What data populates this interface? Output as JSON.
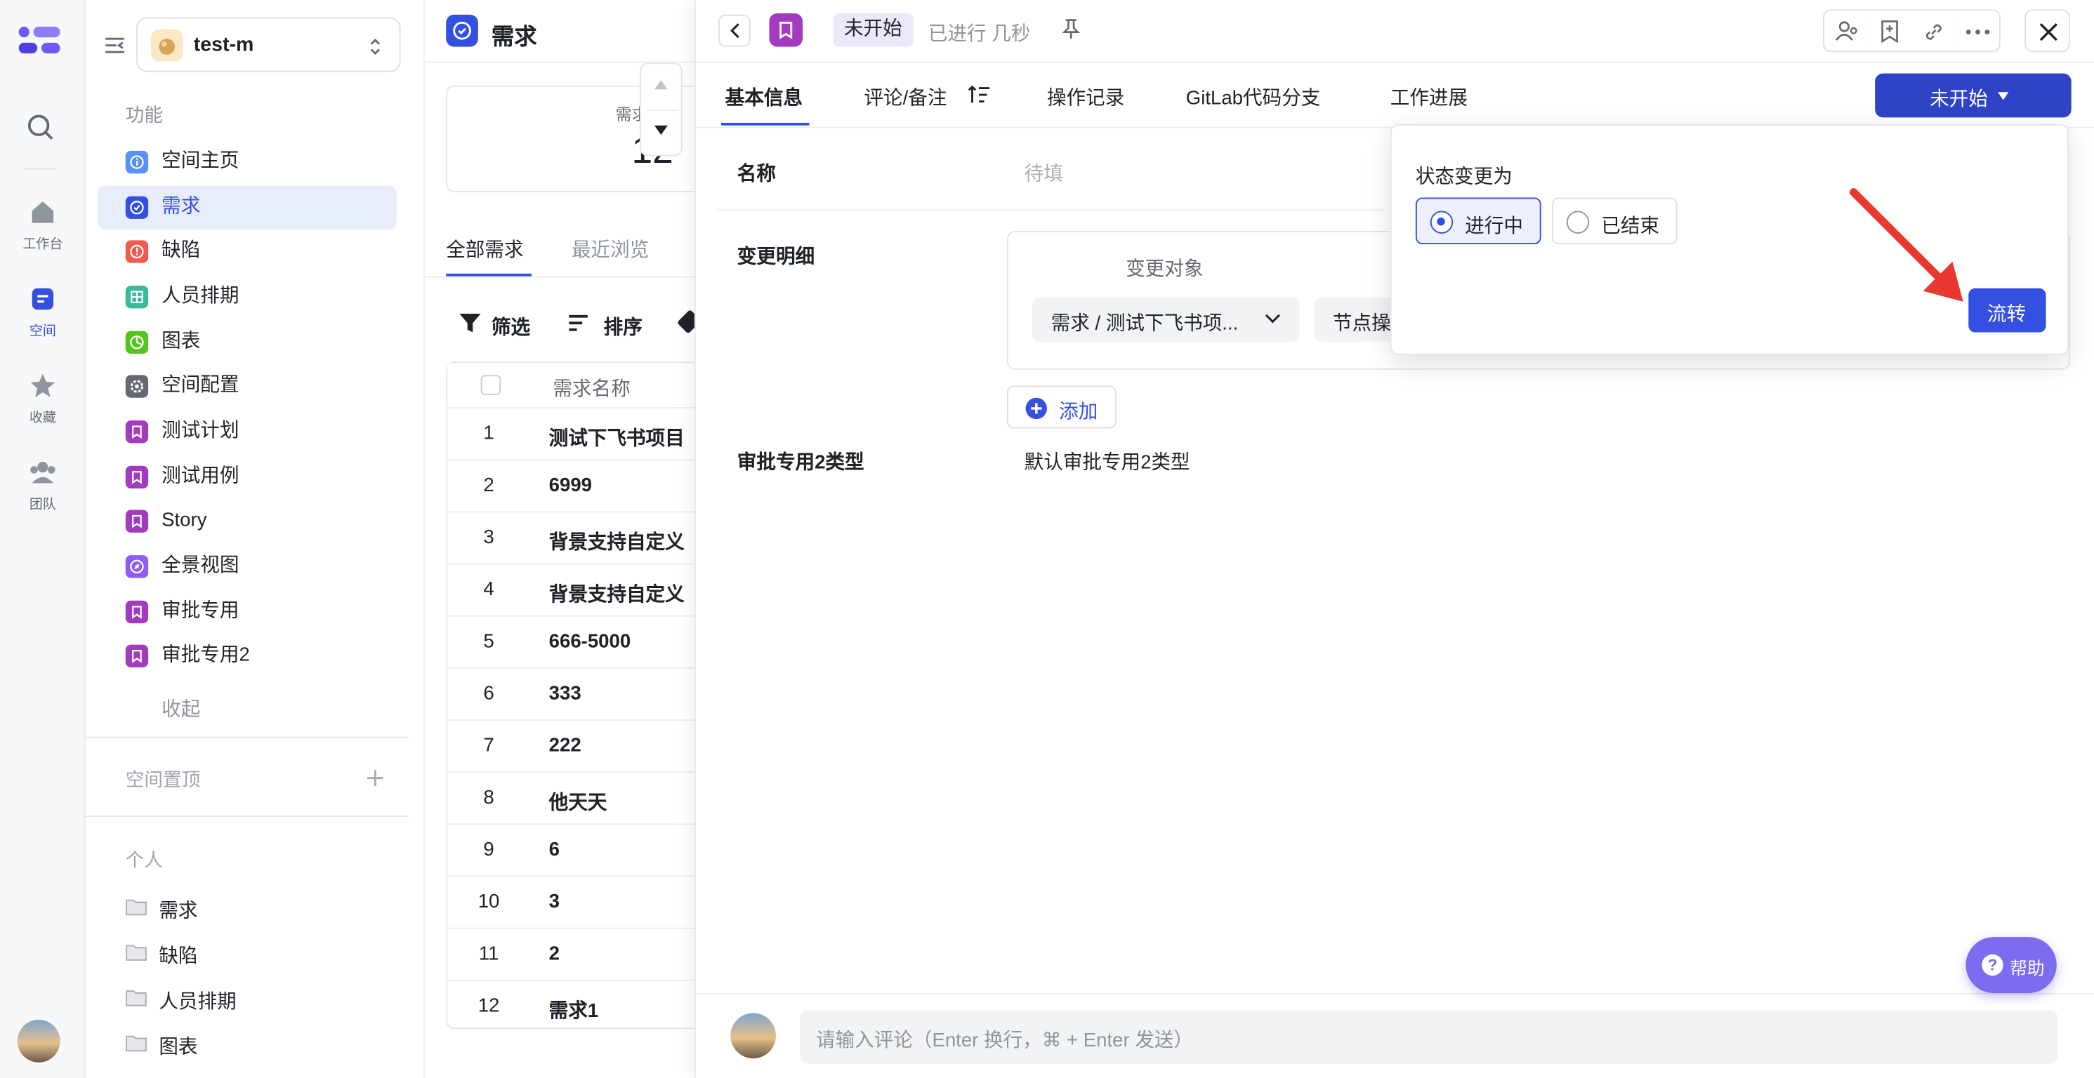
{
  "rail": {
    "items": [
      {
        "label": "工作台",
        "icon": "home-icon"
      },
      {
        "label": "空间",
        "icon": "space-icon"
      },
      {
        "label": "收藏",
        "icon": "star-icon"
      },
      {
        "label": "团队",
        "icon": "team-icon"
      }
    ]
  },
  "sidebar": {
    "space_name": "test-m",
    "section_features": "功能",
    "items": [
      {
        "label": "空间主页",
        "color": "#5b8ff9"
      },
      {
        "label": "需求",
        "color": "#3450e0"
      },
      {
        "label": "缺陷",
        "color": "#f05a4f"
      },
      {
        "label": "人员排期",
        "color": "#3bb99b"
      },
      {
        "label": "图表",
        "color": "#52c41a"
      },
      {
        "label": "空间配置",
        "color": "#646a73"
      },
      {
        "label": "测试计划",
        "color": "#a33bc0"
      },
      {
        "label": "测试用例",
        "color": "#a33bc0"
      },
      {
        "label": "Story",
        "color": "#a33bc0"
      },
      {
        "label": "全景视图",
        "color": "#8e5cf6"
      },
      {
        "label": "审批专用",
        "color": "#a33bc0"
      },
      {
        "label": "审批专用2",
        "color": "#a33bc0"
      }
    ],
    "collapse": "收起",
    "section_pinned": "空间置顶",
    "section_personal": "个人",
    "folders": [
      "需求",
      "缺陷",
      "人员排期",
      "图表"
    ]
  },
  "list": {
    "title": "需求",
    "card_label": "需求",
    "card_count": "12",
    "tabs": [
      "全部需求",
      "最近浏览"
    ],
    "filter": "筛选",
    "sort": "排序",
    "col_name": "需求名称",
    "rows": [
      {
        "num": "1",
        "name": "测试下飞书项目"
      },
      {
        "num": "2",
        "name": "6999"
      },
      {
        "num": "3",
        "name": "背景支持自定义"
      },
      {
        "num": "4",
        "name": "背景支持自定义"
      },
      {
        "num": "5",
        "name": "666-5000"
      },
      {
        "num": "6",
        "name": "333"
      },
      {
        "num": "7",
        "name": "222"
      },
      {
        "num": "8",
        "name": "他天天"
      },
      {
        "num": "9",
        "name": "6"
      },
      {
        "num": "10",
        "name": "3"
      },
      {
        "num": "11",
        "name": "2"
      },
      {
        "num": "12",
        "name": "需求1"
      }
    ]
  },
  "detail": {
    "status_tag": "未开始",
    "elapsed": "已进行 几秒",
    "tabs": [
      "基本信息",
      "评论/备注",
      "操作记录",
      "GitLab代码分支",
      "工作进展"
    ],
    "status_button": "未开始",
    "fields": {
      "name_label": "名称",
      "name_placeholder": "待填",
      "change_label": "变更明细",
      "change_object": "变更对象",
      "change_select": "需求 / 测试下飞书项...",
      "node_op": "节点操",
      "add": "添加",
      "approval_label": "审批专用2类型",
      "approval_value": "默认审批专用2类型"
    },
    "comment_placeholder": "请输入评论（Enter 换行，⌘ + Enter 发送）",
    "help": "帮助"
  },
  "popover": {
    "title": "状态变更为",
    "options": [
      "进行中",
      "已结束"
    ],
    "selected": "进行中",
    "confirm": "流转"
  },
  "colors": {
    "accent": "#3450e0",
    "button_dark": "#2f43c7",
    "tag_bg": "#ece8fb",
    "arrow": "#e8382f"
  }
}
